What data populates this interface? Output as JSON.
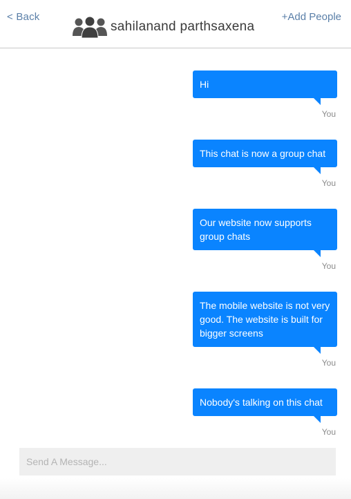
{
  "header": {
    "back_label": "< Back",
    "title": "sahilanand parthsaxena",
    "add_people_label": "+Add People",
    "group_icon": "group-people-icon"
  },
  "messages": [
    {
      "text": "Hi",
      "sender": "You"
    },
    {
      "text": "This chat is now a group chat",
      "sender": "You"
    },
    {
      "text": "Our website now supports group chats",
      "sender": "You"
    },
    {
      "text": "The mobile website is not very good. The website is built for bigger screens",
      "sender": "You"
    },
    {
      "text": "Nobody's talking on this chat",
      "sender": "You"
    }
  ],
  "composer": {
    "placeholder": "Send A Message..."
  },
  "colors": {
    "bubble": "#0a84ff",
    "link": "#5a7fa8"
  }
}
